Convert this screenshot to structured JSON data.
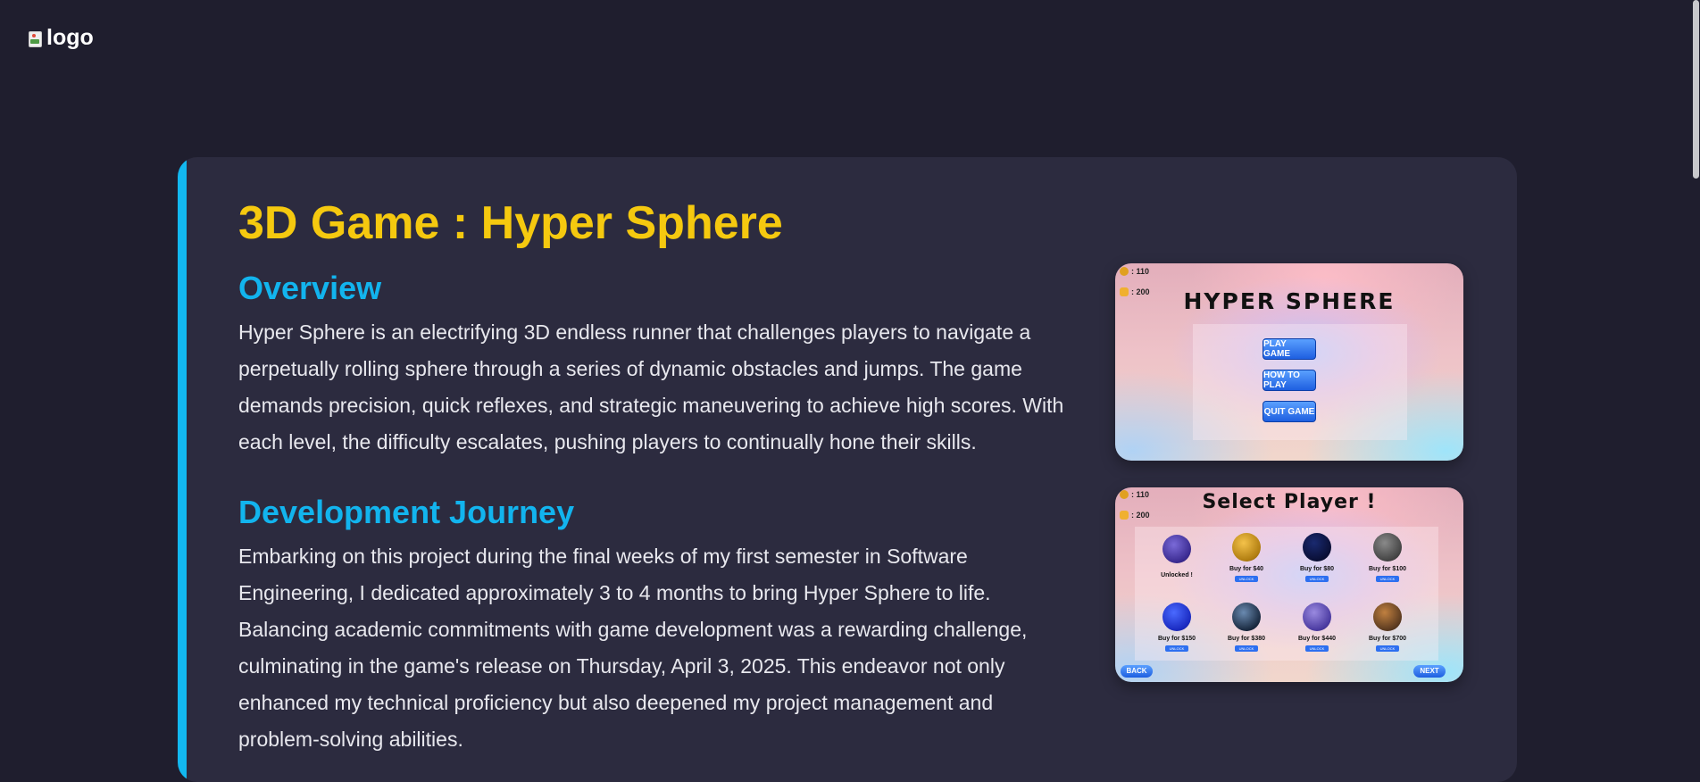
{
  "header": {
    "logo_alt": "logo"
  },
  "project": {
    "title": "3D Game : Hyper Sphere",
    "sections": [
      {
        "heading": "Overview",
        "body": "Hyper Sphere is an electrifying 3D endless runner that challenges players to navigate a perpetually rolling sphere through a series of dynamic obstacles and jumps. The game demands precision, quick reflexes, and strategic maneuvering to achieve high scores. With each level, the difficulty escalates, pushing players to continually hone their skills."
      },
      {
        "heading": "Development Journey",
        "body": "Embarking on this project during the final weeks of my first semester in Software Engineering, I dedicated approximately 3 to 4 months to bring Hyper Sphere to life. Balancing academic commitments with game development was a rewarding challenge, culminating in the game's release on Thursday, April 3, 2025. This endeavor not only enhanced my technical proficiency but also deepened my project management and problem-solving abilities."
      }
    ]
  },
  "screenshots": {
    "main_menu": {
      "coins": ": 110",
      "gems": ": 200",
      "title": "HYPER SPHERE",
      "buttons": [
        "PLAY GAME",
        "HOW TO PLAY",
        "QUIT GAME"
      ]
    },
    "select_player": {
      "coins": ": 110",
      "gems": ": 200",
      "title": "Select Player !",
      "row1": [
        "Unlocked !",
        "Buy for $40",
        "Buy for $80",
        "Buy for $100"
      ],
      "row2": [
        "Buy for $150",
        "Buy for $380",
        "Buy for $440",
        "Buy for $700"
      ],
      "unlock_label": "UNLOCK",
      "back_label": "BACK",
      "next_label": "NEXT"
    }
  },
  "colors": {
    "background": "#1f1e2e",
    "card": "#2c2b3f",
    "accent": "#12b8f0",
    "title": "#f5c90f",
    "heading": "#12b4ee"
  }
}
